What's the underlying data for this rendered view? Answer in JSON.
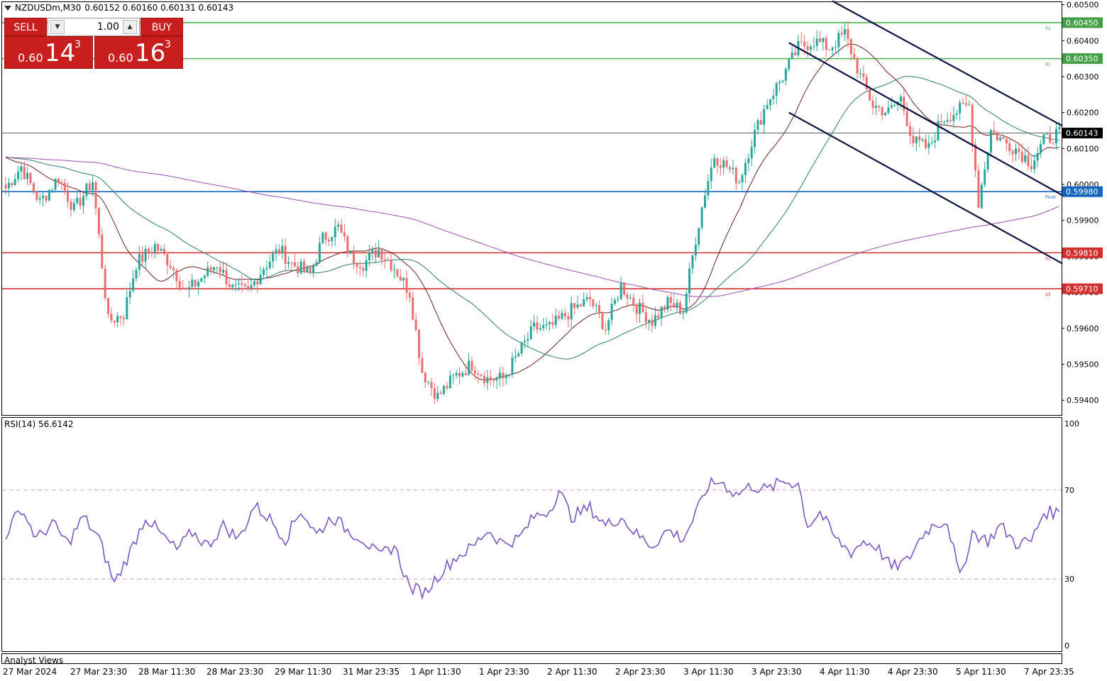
{
  "header": {
    "symbol": "NZDUSDm,M30",
    "ohlc": "0.60152 0.60160 0.60131 0.60143"
  },
  "trade_panel": {
    "sell_label": "SELL",
    "buy_label": "BUY",
    "lot_value": "1.00",
    "sell_price": {
      "prefix": "0.60",
      "big": "14",
      "sup": "3"
    },
    "buy_price": {
      "prefix": "0.60",
      "big": "16",
      "sup": "3"
    }
  },
  "price_axis": {
    "ticks": [
      "0.60500",
      "0.60400",
      "0.60300",
      "0.60200",
      "0.60100",
      "0.60000",
      "0.59900",
      "0.59800",
      "0.59700",
      "0.59600",
      "0.59500",
      "0.59400"
    ],
    "range": [
      0.5936,
      0.6051
    ]
  },
  "levels": [
    {
      "value": 0.6045,
      "label": "0.60450",
      "color": "#4caf50",
      "tag": "R2"
    },
    {
      "value": 0.6035,
      "label": "0.60350",
      "color": "#4caf50",
      "tag": "R1"
    },
    {
      "value": 0.60143,
      "label": "0.60143",
      "color": "#000000",
      "tag": ""
    },
    {
      "value": 0.5998,
      "label": "0.59980",
      "color": "#1565c0",
      "tag": "Pivot"
    },
    {
      "value": 0.5981,
      "label": "0.59810",
      "color": "#d32f2f",
      "tag": "S2"
    },
    {
      "value": 0.5971,
      "label": "0.59710",
      "color": "#d32f2f",
      "tag": "S3"
    }
  ],
  "rsi": {
    "label": "RSI(14) 56.6142",
    "ticks": [
      "100",
      "70",
      "30",
      "0"
    ],
    "overbought": 70,
    "oversold": 30,
    "color": "#7e57c2"
  },
  "footer": {
    "analyst": "Analyst Views",
    "time_labels": [
      "27 Mar 2024",
      "27 Mar 23:30",
      "28 Mar 11:30",
      "28 Mar 23:30",
      "29 Mar 11:30",
      "31 Mar 23:35",
      "1 Apr 11:30",
      "1 Apr 23:30",
      "2 Apr 11:30",
      "2 Apr 23:30",
      "3 Apr 11:30",
      "3 Apr 23:30",
      "4 Apr 11:30",
      "4 Apr 23:30",
      "5 Apr 11:30",
      "7 Apr 23:35"
    ]
  },
  "colors": {
    "bull": "#26a69a",
    "bear": "#ef6c6c",
    "ma_fast": "#6d1f1f",
    "ma_mid": "#2e7d6e",
    "ma_slow": "#9c4fb0",
    "channel": "#0d1440"
  },
  "chart_data": {
    "type": "candlestick",
    "title": "NZDUSDm,M30",
    "anchors": [
      [
        0,
        0.5999
      ],
      [
        5,
        0.6005
      ],
      [
        11,
        0.5995
      ],
      [
        17,
        0.6002
      ],
      [
        22,
        0.5993
      ],
      [
        28,
        0.6001
      ],
      [
        33,
        0.5962
      ],
      [
        38,
        0.5964
      ],
      [
        42,
        0.5978
      ],
      [
        48,
        0.5983
      ],
      [
        53,
        0.5978
      ],
      [
        58,
        0.597
      ],
      [
        63,
        0.5974
      ],
      [
        68,
        0.5978
      ],
      [
        73,
        0.5971
      ],
      [
        78,
        0.597
      ],
      [
        83,
        0.5977
      ],
      [
        88,
        0.5982
      ],
      [
        92,
        0.5978
      ],
      [
        98,
        0.5975
      ],
      [
        102,
        0.5985
      ],
      [
        107,
        0.5988
      ],
      [
        111,
        0.598
      ],
      [
        115,
        0.5978
      ],
      [
        120,
        0.5982
      ],
      [
        125,
        0.5977
      ],
      [
        130,
        0.597
      ],
      [
        134,
        0.5948
      ],
      [
        139,
        0.5941
      ],
      [
        145,
        0.5947
      ],
      [
        150,
        0.595
      ],
      [
        155,
        0.5946
      ],
      [
        160,
        0.5946
      ],
      [
        165,
        0.5953
      ],
      [
        170,
        0.596
      ],
      [
        175,
        0.596
      ],
      [
        182,
        0.5965
      ],
      [
        188,
        0.5968
      ],
      [
        193,
        0.596
      ],
      [
        198,
        0.5972
      ],
      [
        203,
        0.5966
      ],
      [
        208,
        0.5962
      ],
      [
        213,
        0.5967
      ],
      [
        218,
        0.5965
      ],
      [
        222,
        0.5985
      ],
      [
        225,
        0.5998
      ],
      [
        228,
        0.6008
      ],
      [
        232,
        0.6005
      ],
      [
        236,
        0.6001
      ],
      [
        240,
        0.6012
      ],
      [
        245,
        0.6023
      ],
      [
        250,
        0.603
      ],
      [
        255,
        0.6038
      ],
      [
        260,
        0.604
      ],
      [
        265,
        0.6038
      ],
      [
        270,
        0.6042
      ],
      [
        275,
        0.603
      ],
      [
        279,
        0.6022
      ],
      [
        284,
        0.602
      ],
      [
        288,
        0.6024
      ],
      [
        292,
        0.6012
      ],
      [
        297,
        0.601
      ],
      [
        301,
        0.6018
      ],
      [
        305,
        0.602
      ],
      [
        310,
        0.6022
      ],
      [
        313,
        0.5995
      ],
      [
        317,
        0.6015
      ],
      [
        321,
        0.6012
      ],
      [
        325,
        0.601
      ],
      [
        330,
        0.6006
      ],
      [
        334,
        0.6012
      ],
      [
        338,
        0.6014
      ]
    ],
    "rsi_anchors": [
      [
        0,
        50
      ],
      [
        5,
        62
      ],
      [
        10,
        48
      ],
      [
        15,
        55
      ],
      [
        20,
        46
      ],
      [
        25,
        58
      ],
      [
        30,
        48
      ],
      [
        35,
        28
      ],
      [
        40,
        42
      ],
      [
        45,
        58
      ],
      [
        50,
        50
      ],
      [
        55,
        43
      ],
      [
        60,
        51
      ],
      [
        65,
        45
      ],
      [
        70,
        54
      ],
      [
        75,
        48
      ],
      [
        80,
        63
      ],
      [
        85,
        57
      ],
      [
        90,
        48
      ],
      [
        95,
        61
      ],
      [
        100,
        50
      ],
      [
        105,
        58
      ],
      [
        110,
        52
      ],
      [
        115,
        48
      ],
      [
        120,
        40
      ],
      [
        125,
        45
      ],
      [
        130,
        26
      ],
      [
        135,
        24
      ],
      [
        140,
        33
      ],
      [
        145,
        40
      ],
      [
        150,
        44
      ],
      [
        155,
        52
      ],
      [
        160,
        46
      ],
      [
        165,
        48
      ],
      [
        170,
        58
      ],
      [
        175,
        61
      ],
      [
        178,
        70
      ],
      [
        182,
        58
      ],
      [
        188,
        62
      ],
      [
        193,
        54
      ],
      [
        198,
        58
      ],
      [
        203,
        50
      ],
      [
        208,
        45
      ],
      [
        213,
        52
      ],
      [
        218,
        48
      ],
      [
        223,
        62
      ],
      [
        226,
        72
      ],
      [
        230,
        74
      ],
      [
        235,
        68
      ],
      [
        240,
        72
      ],
      [
        245,
        70
      ],
      [
        250,
        74
      ],
      [
        255,
        73
      ],
      [
        258,
        54
      ],
      [
        262,
        60
      ],
      [
        267,
        48
      ],
      [
        272,
        42
      ],
      [
        276,
        47
      ],
      [
        280,
        45
      ],
      [
        285,
        35
      ],
      [
        290,
        38
      ],
      [
        295,
        50
      ],
      [
        299,
        55
      ],
      [
        303,
        56
      ],
      [
        307,
        30
      ],
      [
        311,
        51
      ],
      [
        316,
        47
      ],
      [
        320,
        54
      ],
      [
        325,
        46
      ],
      [
        330,
        47
      ],
      [
        334,
        60
      ]
    ],
    "n_candles": 340,
    "channel_lines": [
      [
        [
          266,
          0.6051
        ],
        [
          340,
          0.60163
        ]
      ],
      [
        [
          252,
          0.60394
        ],
        [
          340,
          0.5997
        ]
      ],
      [
        [
          252,
          0.602
        ],
        [
          340,
          0.5978
        ]
      ]
    ]
  }
}
